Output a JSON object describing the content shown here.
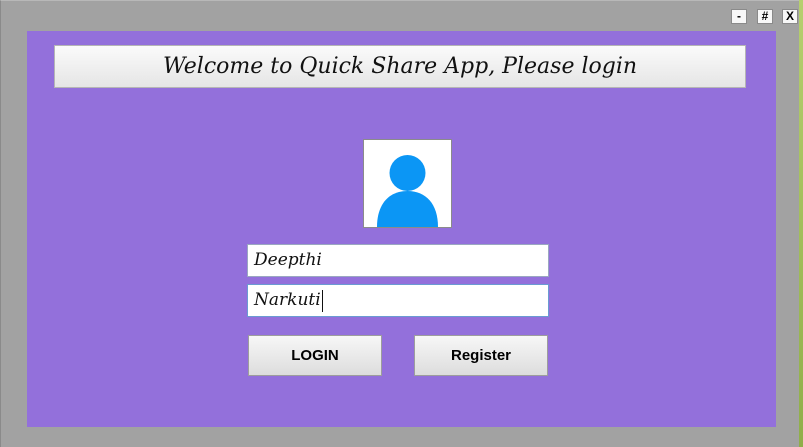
{
  "window": {
    "controls": {
      "minimize_label": "-",
      "maximize_label": "#",
      "close_label": "X"
    }
  },
  "header": {
    "title": "Welcome to Quick Share App, Please login"
  },
  "avatar": {
    "icon": "user-icon",
    "color": "#0b96f5"
  },
  "form": {
    "username_value": "Deepthi",
    "password_value": "Narkuti"
  },
  "buttons": {
    "login_label": "LOGIN",
    "register_label": "Register"
  },
  "colors": {
    "panel": "#9370db",
    "window_frame": "#a2a2a2",
    "accent": "#0b96f5"
  }
}
